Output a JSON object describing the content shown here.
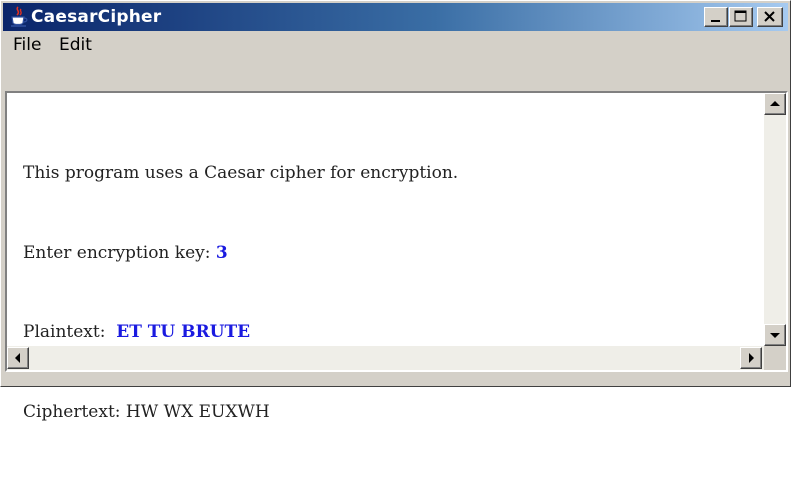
{
  "window": {
    "title": "CaesarCipher"
  },
  "menu": {
    "items": [
      {
        "label": "File"
      },
      {
        "label": "Edit"
      }
    ]
  },
  "console": {
    "line1": "This program uses a Caesar cipher for encryption.",
    "line2_prompt": "Enter encryption key: ",
    "line2_value": "3",
    "line3_prompt": "Plaintext:  ",
    "line3_value": "ET TU BRUTE",
    "line4_prompt": "Ciphertext: ",
    "line4_value": "HW WX EUXWH"
  },
  "colors": {
    "title_bar_start": "#0a246a",
    "title_bar_end": "#a6caf0",
    "user_input": "#1a1ae0",
    "window_face": "#d4d0c8"
  },
  "icons": {
    "app": "java-coffee-cup-icon",
    "minimize": "minimize-icon",
    "maximize": "maximize-icon",
    "close": "close-icon",
    "scroll_up": "arrow-up-icon",
    "scroll_down": "arrow-down-icon",
    "scroll_left": "arrow-left-icon",
    "scroll_right": "arrow-right-icon"
  }
}
